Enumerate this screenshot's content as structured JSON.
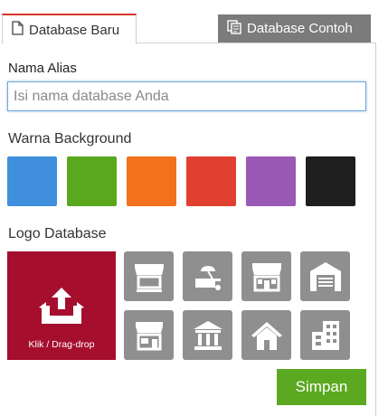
{
  "tabs": [
    {
      "label": "Database Baru",
      "icon": "document-icon",
      "active": true
    },
    {
      "label": "Database Contoh",
      "icon": "copy-icon",
      "active": false
    }
  ],
  "alias": {
    "label": "Nama Alias",
    "value": "",
    "placeholder": "Isi nama database Anda"
  },
  "background": {
    "label": "Warna Background",
    "colors": [
      "#3f8fdd",
      "#5aa81e",
      "#f2711c",
      "#e13f30",
      "#9b59b6",
      "#1e1e1e"
    ]
  },
  "logo": {
    "label": "Logo Database",
    "upload_caption": "Klik / Drag-drop",
    "upload_color": "#a50f2d",
    "icons": [
      "market-stall-icon",
      "cart-stand-icon",
      "store-front-icon",
      "warehouse-icon",
      "shop-icon",
      "bank-icon",
      "house-icon",
      "buildings-icon"
    ]
  },
  "save_label": "Simpan"
}
